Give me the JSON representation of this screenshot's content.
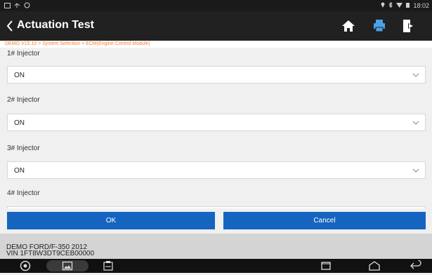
{
  "status_bar": {
    "time": "18:02"
  },
  "app_bar": {
    "title": "Actuation Test"
  },
  "breadcrumb": "DEMO V15.10 > System Selection > ECM(Engine Control Module)",
  "items": [
    {
      "label": "1# Injector",
      "value": "ON"
    },
    {
      "label": "2# Injector",
      "value": "ON"
    },
    {
      "label": "3# Injector",
      "value": "ON"
    },
    {
      "label": "4# Injector",
      "value": ""
    }
  ],
  "buttons": {
    "ok": "OK",
    "cancel": "Cancel"
  },
  "vehicle": {
    "line1": "DEMO FORD/F-350 2012",
    "line2": "VIN 1FT8W3DT9CEB00000"
  },
  "colors": {
    "accent": "#1565c0",
    "breadcrumb": "#ff7a2f",
    "appbar": "#212121"
  },
  "nav_icons": [
    "chrome-icon",
    "gallery-icon",
    "vci-icon",
    "recent-apps-icon",
    "home-icon",
    "back-icon"
  ]
}
